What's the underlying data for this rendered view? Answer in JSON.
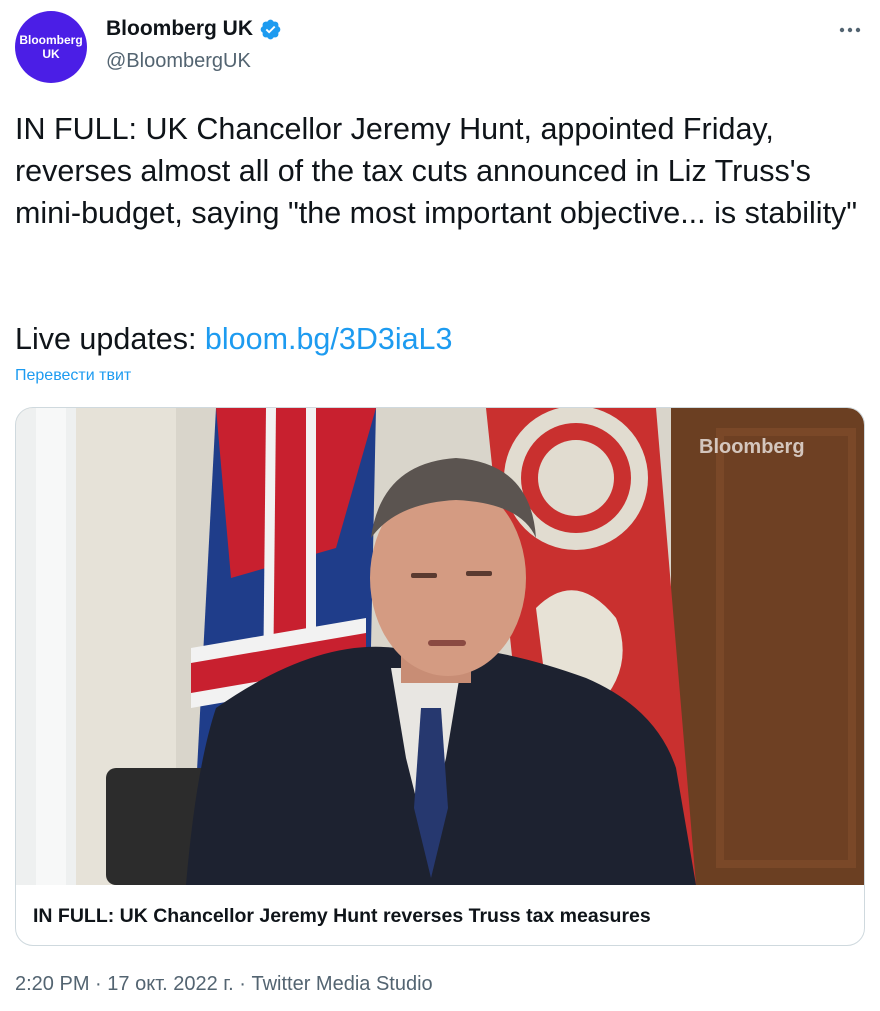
{
  "author": {
    "avatar_line1": "Bloomberg",
    "avatar_line2": "UK",
    "display_name": "Bloomberg UK",
    "handle": "@BloombergUK",
    "verified_icon": "verified-badge-icon",
    "more_icon": "more-options-icon"
  },
  "tweet": {
    "text": "IN FULL: UK Chancellor Jeremy Hunt, appointed Friday, reverses almost all of the tax cuts announced in Liz Truss's mini-budget, saying \"the most important objective... is stability\"",
    "live_prefix": "Live updates: ",
    "link_text": "bloom.bg/3D3iaL3",
    "translate_label": "Перевести твит"
  },
  "media_card": {
    "watermark": "Bloomberg",
    "title": "IN FULL: UK Chancellor Jeremy Hunt reverses Truss tax measures"
  },
  "meta": {
    "time": "2:20 PM",
    "sep1": " · ",
    "date": "17 окт. 2022 г.",
    "sep2": " · ",
    "source": "Twitter Media Studio"
  },
  "colors": {
    "link": "#1d9bf0",
    "avatar_bg": "#4b1ee6",
    "secondary_text": "#536471",
    "border": "#cfd9de"
  }
}
